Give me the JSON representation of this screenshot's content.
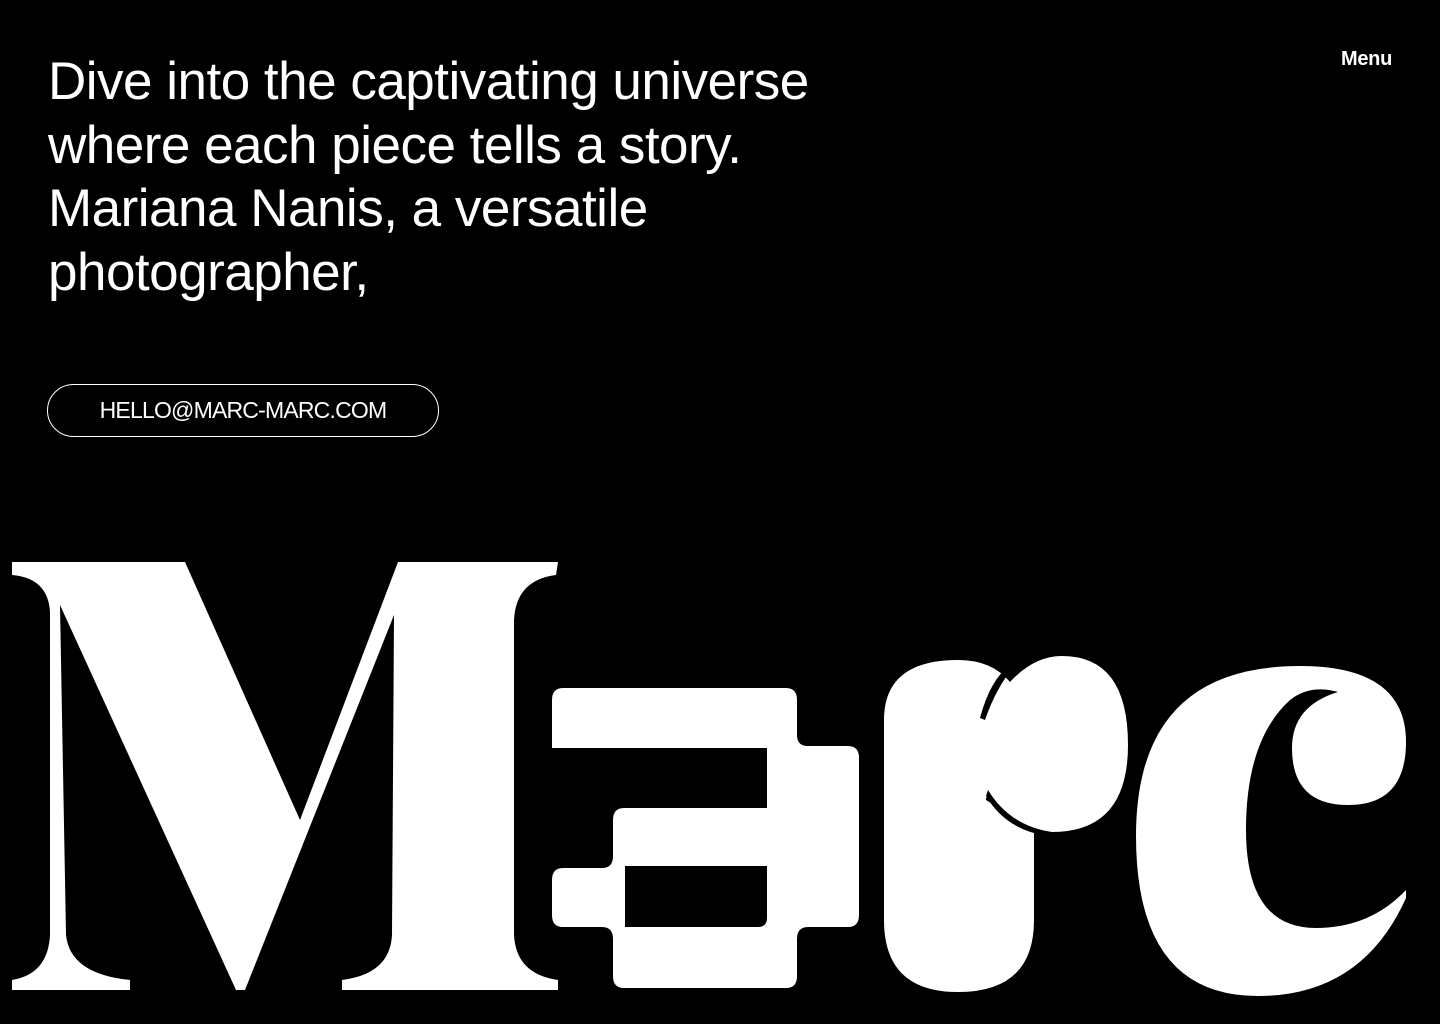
{
  "hero": {
    "text": "Dive into the captivating universe where each piece tells a story. Mariana Nanis, a versatile photographer,"
  },
  "nav": {
    "menu_label": "Menu"
  },
  "contact": {
    "email": "HELLO@MARC-MARC.COM"
  },
  "brand": {
    "wordmark": "Marc"
  },
  "colors": {
    "background": "#000000",
    "foreground": "#ffffff"
  }
}
